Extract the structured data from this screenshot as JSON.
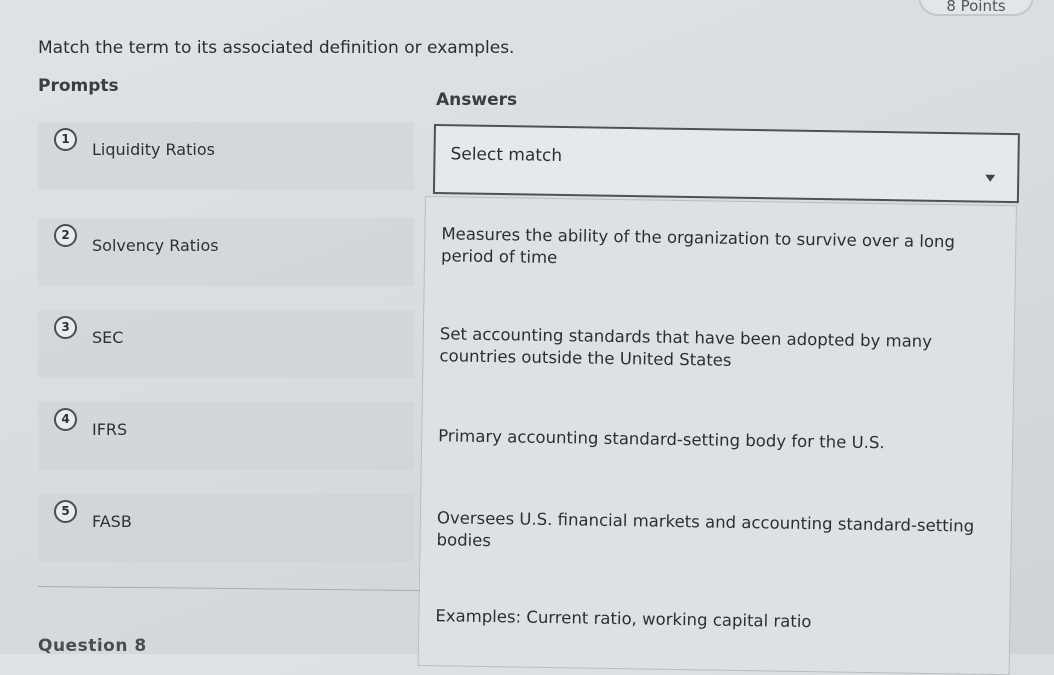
{
  "points_label": "8 Points",
  "instruction": "Match the term to its associated definition or examples.",
  "prompts_heading": "Prompts",
  "answers_heading": "Answers",
  "prompts": [
    {
      "number": "1",
      "label": "Liquidity Ratios"
    },
    {
      "number": "2",
      "label": "Solvency Ratios"
    },
    {
      "number": "3",
      "label": "SEC"
    },
    {
      "number": "4",
      "label": "IFRS"
    },
    {
      "number": "5",
      "label": "FASB"
    }
  ],
  "select": {
    "label": "Select match",
    "icon": "caret-down-icon"
  },
  "answers": [
    "Measures the ability of the organization to survive over a long period of time",
    "Set accounting standards that have been adopted by many countries outside the United States",
    "Primary accounting standard-setting body for the U.S.",
    "Oversees U.S. financial markets and accounting standard-setting bodies",
    "Examples: Current ratio, working capital ratio"
  ],
  "next_question": "Question 8"
}
